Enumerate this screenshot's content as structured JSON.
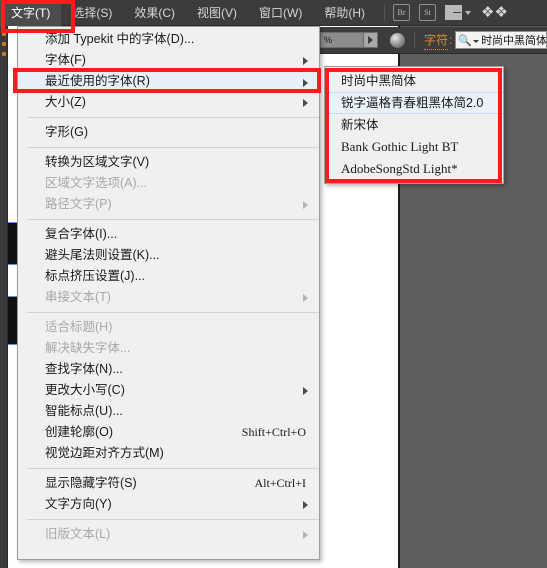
{
  "menubar": {
    "items": [
      {
        "label": "文字(T)",
        "active": true
      },
      {
        "label": "选择(S)",
        "active": false
      },
      {
        "label": "效果(C)",
        "active": false
      },
      {
        "label": "视图(V)",
        "active": false
      },
      {
        "label": "窗口(W)",
        "active": false
      },
      {
        "label": "帮助(H)",
        "active": false
      }
    ],
    "bridge_icon_label": "Br",
    "stock_icon_label": "St",
    "layout_icon": "arrange-documents-icon",
    "caret_icon": "chevron-down-icon",
    "logo_icon": "illustrator-logo-icon"
  },
  "controlbar": {
    "field_value": "%",
    "go_icon": "play-arrow-icon",
    "sphere_icon": "appearance-sphere-icon",
    "character_label": "字符",
    "colon": ":",
    "search_icon": "search-icon",
    "search_caret_icon": "chevron-down-icon",
    "font_value": "时尚中黑简体"
  },
  "menu": {
    "items": [
      {
        "label": "添加 Typekit 中的字体(D)...",
        "shortcut": "",
        "arrow": false,
        "disabled": false,
        "highlight": false,
        "sep_after": false
      },
      {
        "label": "字体(F)",
        "shortcut": "",
        "arrow": true,
        "disabled": false,
        "highlight": false,
        "sep_after": false
      },
      {
        "label": "最近使用的字体(R)",
        "shortcut": "",
        "arrow": true,
        "disabled": false,
        "highlight": true,
        "sep_after": false
      },
      {
        "label": "大小(Z)",
        "shortcut": "",
        "arrow": true,
        "disabled": false,
        "highlight": false,
        "sep_after": true
      },
      {
        "label": "字形(G)",
        "shortcut": "",
        "arrow": false,
        "disabled": false,
        "highlight": false,
        "sep_after": true
      },
      {
        "label": "转换为区域文字(V)",
        "shortcut": "",
        "arrow": false,
        "disabled": false,
        "highlight": false,
        "sep_after": false
      },
      {
        "label": "区域文字选项(A)...",
        "shortcut": "",
        "arrow": false,
        "disabled": true,
        "highlight": false,
        "sep_after": false
      },
      {
        "label": "路径文字(P)",
        "shortcut": "",
        "arrow": true,
        "disabled": true,
        "highlight": false,
        "sep_after": true
      },
      {
        "label": "复合字体(I)...",
        "shortcut": "",
        "arrow": false,
        "disabled": false,
        "highlight": false,
        "sep_after": false
      },
      {
        "label": "避头尾法则设置(K)...",
        "shortcut": "",
        "arrow": false,
        "disabled": false,
        "highlight": false,
        "sep_after": false
      },
      {
        "label": "标点挤压设置(J)...",
        "shortcut": "",
        "arrow": false,
        "disabled": false,
        "highlight": false,
        "sep_after": false
      },
      {
        "label": "串接文本(T)",
        "shortcut": "",
        "arrow": true,
        "disabled": true,
        "highlight": false,
        "sep_after": true
      },
      {
        "label": "适合标题(H)",
        "shortcut": "",
        "arrow": false,
        "disabled": true,
        "highlight": false,
        "sep_after": false
      },
      {
        "label": "解决缺失字体...",
        "shortcut": "",
        "arrow": false,
        "disabled": true,
        "highlight": false,
        "sep_after": false
      },
      {
        "label": "查找字体(N)...",
        "shortcut": "",
        "arrow": false,
        "disabled": false,
        "highlight": false,
        "sep_after": false
      },
      {
        "label": "更改大小写(C)",
        "shortcut": "",
        "arrow": true,
        "disabled": false,
        "highlight": false,
        "sep_after": false
      },
      {
        "label": "智能标点(U)...",
        "shortcut": "",
        "arrow": false,
        "disabled": false,
        "highlight": false,
        "sep_after": false
      },
      {
        "label": "创建轮廓(O)",
        "shortcut": "Shift+Ctrl+O",
        "arrow": false,
        "disabled": false,
        "highlight": false,
        "sep_after": false
      },
      {
        "label": "视觉边距对齐方式(M)",
        "shortcut": "",
        "arrow": false,
        "disabled": false,
        "highlight": false,
        "sep_after": true
      },
      {
        "label": "显示隐藏字符(S)",
        "shortcut": "Alt+Ctrl+I",
        "arrow": false,
        "disabled": false,
        "highlight": false,
        "sep_after": false
      },
      {
        "label": "文字方向(Y)",
        "shortcut": "",
        "arrow": true,
        "disabled": false,
        "highlight": false,
        "sep_after": true
      },
      {
        "label": "旧版文本(L)",
        "shortcut": "",
        "arrow": true,
        "disabled": true,
        "highlight": false,
        "sep_after": false
      }
    ]
  },
  "submenu": {
    "items": [
      {
        "label": "时尚中黑简体",
        "highlight": false,
        "latin": false
      },
      {
        "label": "锐字逼格青春粗黑体简2.0",
        "highlight": true,
        "latin": false
      },
      {
        "label": "新宋体",
        "highlight": false,
        "latin": false
      },
      {
        "label": "Bank Gothic Light BT",
        "highlight": false,
        "latin": true
      },
      {
        "label": "AdobeSongStd Light*",
        "highlight": false,
        "latin": true
      }
    ]
  },
  "annotations": {
    "color": "#fe1b1b",
    "boxes": [
      {
        "name": "highlight-type-menu"
      },
      {
        "name": "highlight-recent-fonts-item"
      },
      {
        "name": "highlight-recent-fonts-submenu"
      }
    ]
  }
}
